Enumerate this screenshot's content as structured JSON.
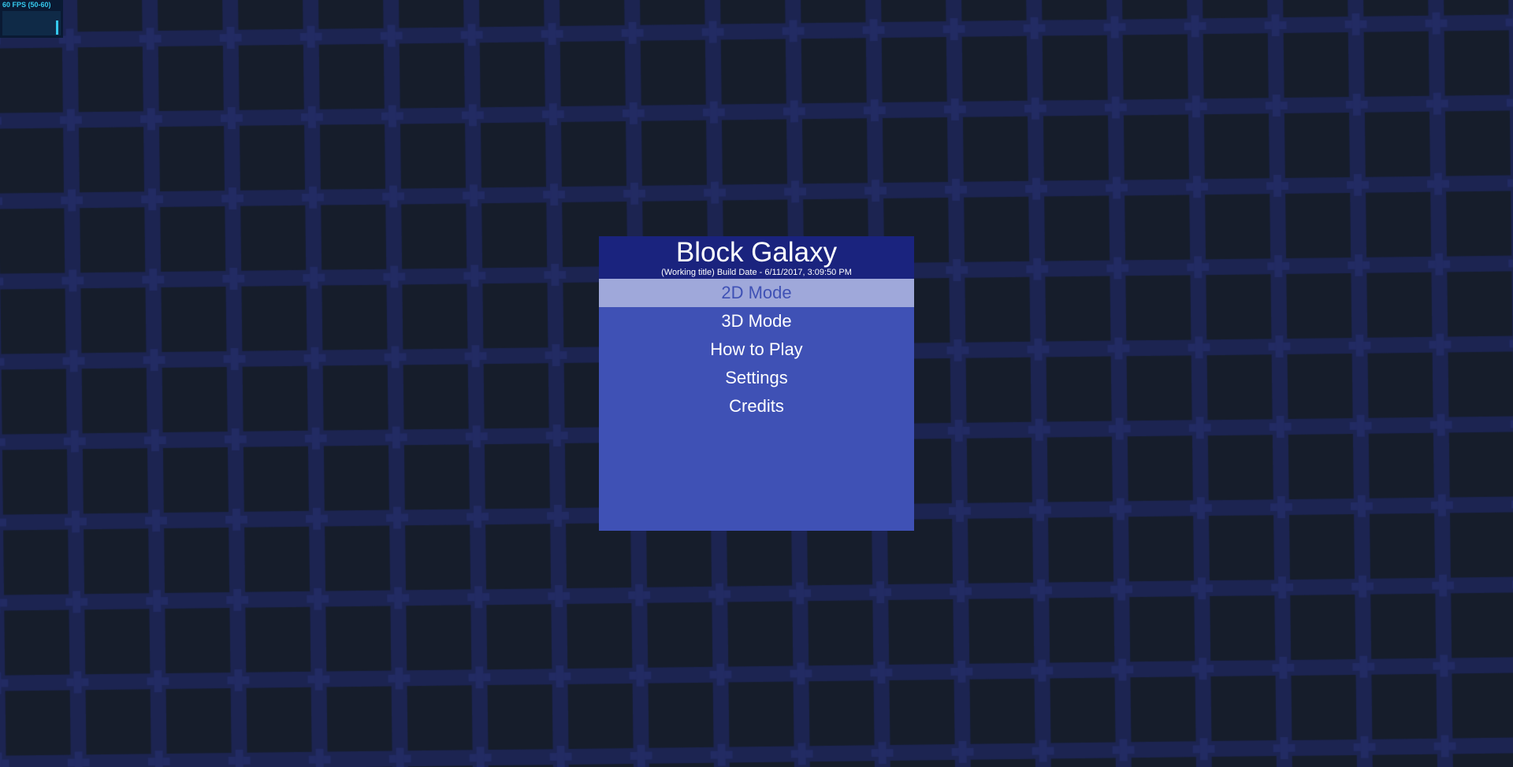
{
  "fps_meter": {
    "label": "60 FPS (50-60)",
    "color": "#35c9ee"
  },
  "background": {
    "base_color": "#1c2451",
    "tile_color": "#161d2b"
  },
  "menu": {
    "title": "Block Galaxy",
    "subtitle": "(Working title) Build Date - 6/11/2017, 3:09:50 PM",
    "header_color": "#1a237e",
    "panel_color": "#3f51b5",
    "selected_color": "#9fa8da",
    "items": [
      {
        "label": "2D Mode",
        "selected": true
      },
      {
        "label": "3D Mode",
        "selected": false
      },
      {
        "label": "How to Play",
        "selected": false
      },
      {
        "label": "Settings",
        "selected": false
      },
      {
        "label": "Credits",
        "selected": false
      }
    ]
  }
}
